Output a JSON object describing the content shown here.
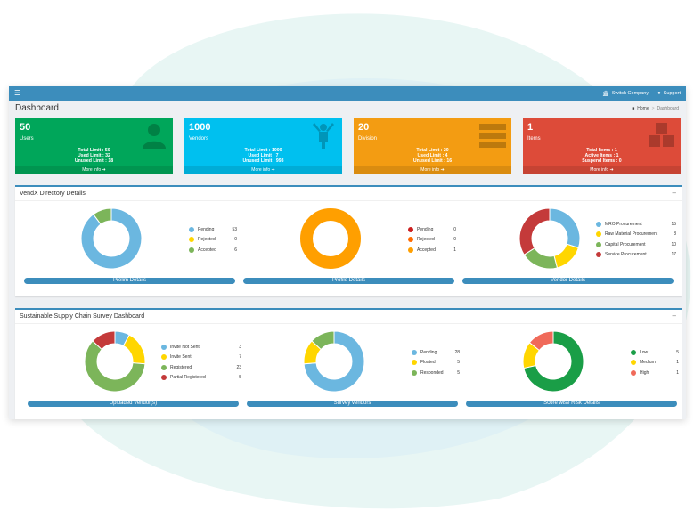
{
  "topbar": {
    "menu_icon": "hamburger-icon",
    "switch_company": "Switch Company",
    "support": "Support"
  },
  "page": {
    "title": "Dashboard"
  },
  "breadcrumb": {
    "home": "Home",
    "current": "Dashboard"
  },
  "tiles": [
    {
      "number": "50",
      "label": "Users",
      "color": "#00a65a",
      "icon": "user-icon",
      "stats": [
        "Total Limit : 50",
        "Used Limit : 32",
        "Unused Limit : 18"
      ],
      "more": "More info"
    },
    {
      "number": "1000",
      "label": "Vendors",
      "color": "#00c0ef",
      "icon": "person-cheer-icon",
      "stats": [
        "Total Limit : 1000",
        "Used Limit : 7",
        "Unused Limit : 993"
      ],
      "more": "More info"
    },
    {
      "number": "20",
      "label": "Division",
      "color": "#f39c12",
      "icon": "server-icon",
      "stats": [
        "Total Limit : 20",
        "Used Limit : 4",
        "Unused Limit : 16"
      ],
      "more": "More info"
    },
    {
      "number": "1",
      "label": "Items",
      "color": "#dd4b39",
      "icon": "cubes-icon",
      "stats": [
        "Total Items : 1",
        "Active Items : 1",
        "Suspend Items : 0"
      ],
      "more": "More info"
    }
  ],
  "directory": {
    "title": "VendX Directory Details",
    "charts": [
      {
        "footer": "Prelim Details",
        "legend": [
          {
            "label": "Pending",
            "value": 53,
            "color": "#6bb7e0"
          },
          {
            "label": "Rejected",
            "value": 0,
            "color": "#ffd600"
          },
          {
            "label": "Accepted",
            "value": 6,
            "color": "#7cb55a"
          }
        ]
      },
      {
        "footer": "Profile Details",
        "legend": [
          {
            "label": "Pending",
            "value": 0,
            "color": "#cc1f1f"
          },
          {
            "label": "Rejected",
            "value": 0,
            "color": "#ff6a00"
          },
          {
            "label": "Accepted",
            "value": 1,
            "color": "#ff9f00"
          }
        ]
      },
      {
        "footer": "Vendor Details",
        "legend": [
          {
            "label": "MRO Procurement",
            "value": 15,
            "color": "#6bb7e0"
          },
          {
            "label": "Raw Material Procurement",
            "value": 8,
            "color": "#ffd600"
          },
          {
            "label": "Capital Procurement",
            "value": 10,
            "color": "#7cb55a"
          },
          {
            "label": "Service Procurement",
            "value": 17,
            "color": "#c43a3a"
          }
        ]
      }
    ]
  },
  "survey": {
    "title": "Sustainable Supply Chain Survey Dashboard",
    "charts": [
      {
        "footer": "Uploaded Vendor(s)",
        "legend": [
          {
            "label": "Invite Not Sent",
            "value": 3,
            "color": "#6bb7e0"
          },
          {
            "label": "Invite Sent",
            "value": 7,
            "color": "#ffd600"
          },
          {
            "label": "Registered",
            "value": 23,
            "color": "#7cb55a"
          },
          {
            "label": "Partial Registered",
            "value": 5,
            "color": "#c43a3a"
          }
        ]
      },
      {
        "footer": "Survey vendors",
        "legend": [
          {
            "label": "Pending",
            "value": 28,
            "color": "#6bb7e0"
          },
          {
            "label": "Floated",
            "value": 5,
            "color": "#ffd600"
          },
          {
            "label": "Responded",
            "value": 5,
            "color": "#7cb55a"
          }
        ]
      },
      {
        "footer": "Score wise Risk Details",
        "legend": [
          {
            "label": "Low",
            "value": 5,
            "color": "#1a9e47"
          },
          {
            "label": "Medium",
            "value": 1,
            "color": "#ffd600"
          },
          {
            "label": "High",
            "value": 1,
            "color": "#f06a5a"
          }
        ]
      }
    ]
  }
}
